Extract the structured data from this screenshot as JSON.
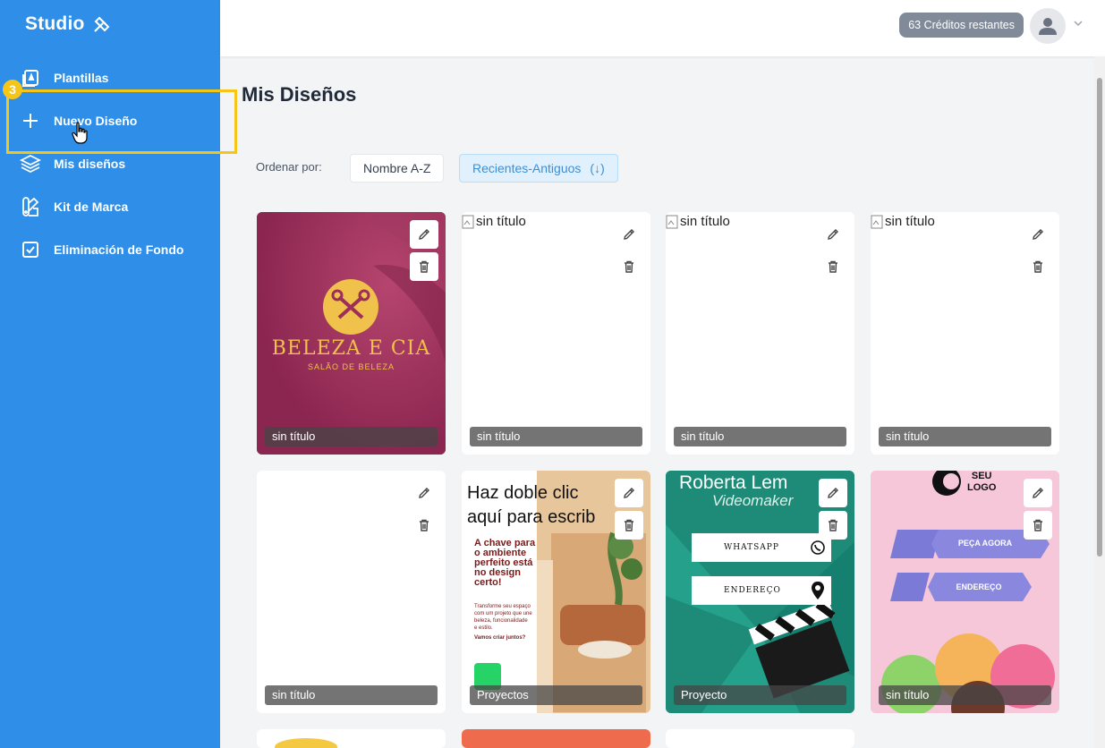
{
  "sidebar": {
    "logo": "Studio",
    "items": [
      {
        "label": "Plantillas",
        "icon": "templates-icon"
      },
      {
        "label": "Nuevo Diseño",
        "icon": "plus-icon"
      },
      {
        "label": "Mis diseños",
        "icon": "layers-icon"
      },
      {
        "label": "Kit de Marca",
        "icon": "brand-kit-icon"
      },
      {
        "label": "Eliminación de Fondo",
        "icon": "checkbox-icon"
      }
    ],
    "step_badge": "3"
  },
  "header": {
    "credits": "63 Créditos restantes"
  },
  "main": {
    "title": "Mis Diseños",
    "sort_label": "Ordenar por:",
    "sort_options": [
      "Nombre A-Z",
      "Recientes-Antiguos",
      "(↓)"
    ],
    "cards": [
      {
        "caption": "sin título",
        "thumb": "beleza"
      },
      {
        "caption": "sin título",
        "alt": "sin título"
      },
      {
        "caption": "sin título",
        "alt": "sin título"
      },
      {
        "caption": "sin título",
        "alt": "sin título"
      },
      {
        "caption": "sin título",
        "thumb": "blank"
      },
      {
        "caption": "Proyectos",
        "thumb": "interior"
      },
      {
        "caption": "Proyecto",
        "thumb": "videomaker"
      },
      {
        "caption": "sin título",
        "thumb": "icecream"
      }
    ],
    "beleza": {
      "title": "BELEZA E CIA",
      "subtitle": "SALÃO DE BELEZA"
    },
    "interior": {
      "line1": "Haz doble clic",
      "line2": "aquí para escrib",
      "headline": [
        "A chave para",
        "o ambiente",
        "perfeito está",
        "no design",
        "certo!"
      ],
      "body": [
        "Transforme seu espaço",
        "com um projeto que une",
        "beleza, funcionalidade",
        "e estilo."
      ],
      "cta": "Vamos criar juntos?"
    },
    "videomaker": {
      "name": "Roberta Lem",
      "role": "Videomaker",
      "btn1": "WHATSAPP",
      "btn2": "ENDEREÇO"
    },
    "icecream": {
      "logo1": "SEU",
      "logo2": "LOGO",
      "btn1": "PEÇA AGORA",
      "btn2": "ENDEREÇO"
    }
  },
  "colors": {
    "sidebar": "#2f8fe8",
    "highlight": "#f5c518",
    "active_sort": "#3b8fd6"
  }
}
